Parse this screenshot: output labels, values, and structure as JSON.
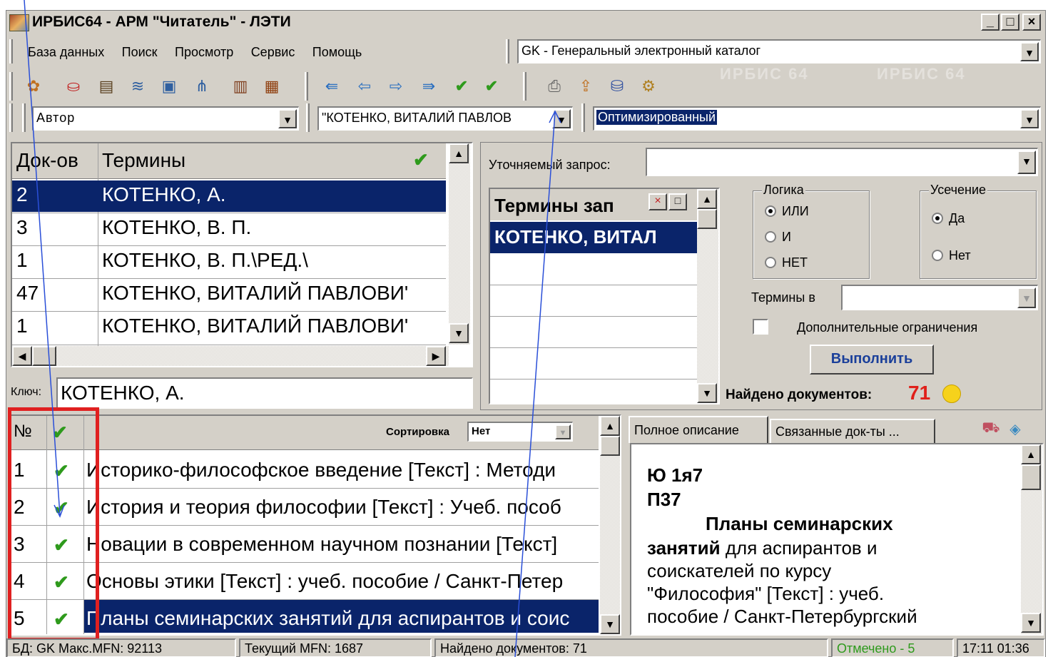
{
  "window": {
    "title": "ИРБИС64 - АРМ \"Читатель\" - ЛЭТИ",
    "buttons": {
      "minimize": "_",
      "maximize": "□",
      "close": "×"
    }
  },
  "menu": {
    "items": [
      "База данных",
      "Поиск",
      "Просмотр",
      "Сервис",
      "Помощь"
    ],
    "database_select": "GK - Генеральный электронный каталог"
  },
  "toolbar": {
    "watermark": "ИРБИС 64"
  },
  "search_bar": {
    "field_select": "Автор",
    "term_select": "\"КОТЕНКО, ВИТАЛИЙ ПАВЛОВ",
    "mode_select": "Оптимизированный"
  },
  "terms_table": {
    "columns": [
      "Док-ов",
      "Термины"
    ],
    "rows": [
      {
        "count": "2",
        "term": "КОТЕНКО, А."
      },
      {
        "count": "3",
        "term": "КОТЕНКО, В. П."
      },
      {
        "count": "1",
        "term": "КОТЕНКО, В. П.\\РЕД.\\"
      },
      {
        "count": "47",
        "term": "КОТЕНКО, ВИТАЛИЙ ПАВЛОВИ'"
      },
      {
        "count": "1",
        "term": "КОТЕНКО, ВИТАЛИЙ ПАВЛОВИ'"
      }
    ],
    "key_label": "Ключ:",
    "key_value": "КОТЕНКО, А."
  },
  "query_panel": {
    "refine_label": "Уточняемый запрос:",
    "terms_box_title": "Термины зап",
    "terms_box_item": "КОТЕНКО, ВИТАЛ",
    "logic_title": "Логика",
    "logic_options": [
      "ИЛИ",
      "И",
      "НЕТ"
    ],
    "trunc_title": "Усечение",
    "trunc_options": [
      "Да",
      "Нет"
    ],
    "terms_in_label": "Термины в",
    "extra_label": "Дополнительные ограничения",
    "execute_label": "Выполнить",
    "found_label": "Найдено документов:",
    "found_count": "71"
  },
  "results": {
    "col_num": "№",
    "sort_label": "Сортировка",
    "sort_value": "Нет",
    "rows": [
      {
        "num": "1",
        "title": "Историко-философское введение [Текст] : Методи"
      },
      {
        "num": "2",
        "title": "История и теория философии [Текст] : Учеб. пособ"
      },
      {
        "num": "3",
        "title": "Новации в современном научном познании [Текст]"
      },
      {
        "num": "4",
        "title": "Основы этики [Текст] : учеб. пособие / Санкт-Петер"
      },
      {
        "num": "5",
        "title": "Планы семинарских занятий для аспирантов и соис"
      }
    ]
  },
  "description": {
    "tabs": [
      "Полное описание",
      "Связанные док-ты ..."
    ],
    "line1": "Ю 1я7",
    "line2": "П37",
    "title_bold": "Планы семинарских",
    "title_bold2": "занятий",
    "rest1": " для аспирантов и",
    "rest2": "соискателей по курсу",
    "rest3": "\"Философия\" [Текст] : учеб.",
    "rest4": "пособие / Санкт-Петербургский"
  },
  "statusbar": {
    "db": "БД: GK Макс.MFN: 92113",
    "current": "Текущий MFN: 1687",
    "found": "Найдено документов: 71",
    "marked": "Отмечено - 5",
    "time": "17:11  01:36"
  },
  "colors": {
    "selection": "#0a246a",
    "found_count": "#e0201a",
    "marked": "#2e9a1c",
    "annotation": "#2a4fd8",
    "highlight_box": "#e02020"
  }
}
